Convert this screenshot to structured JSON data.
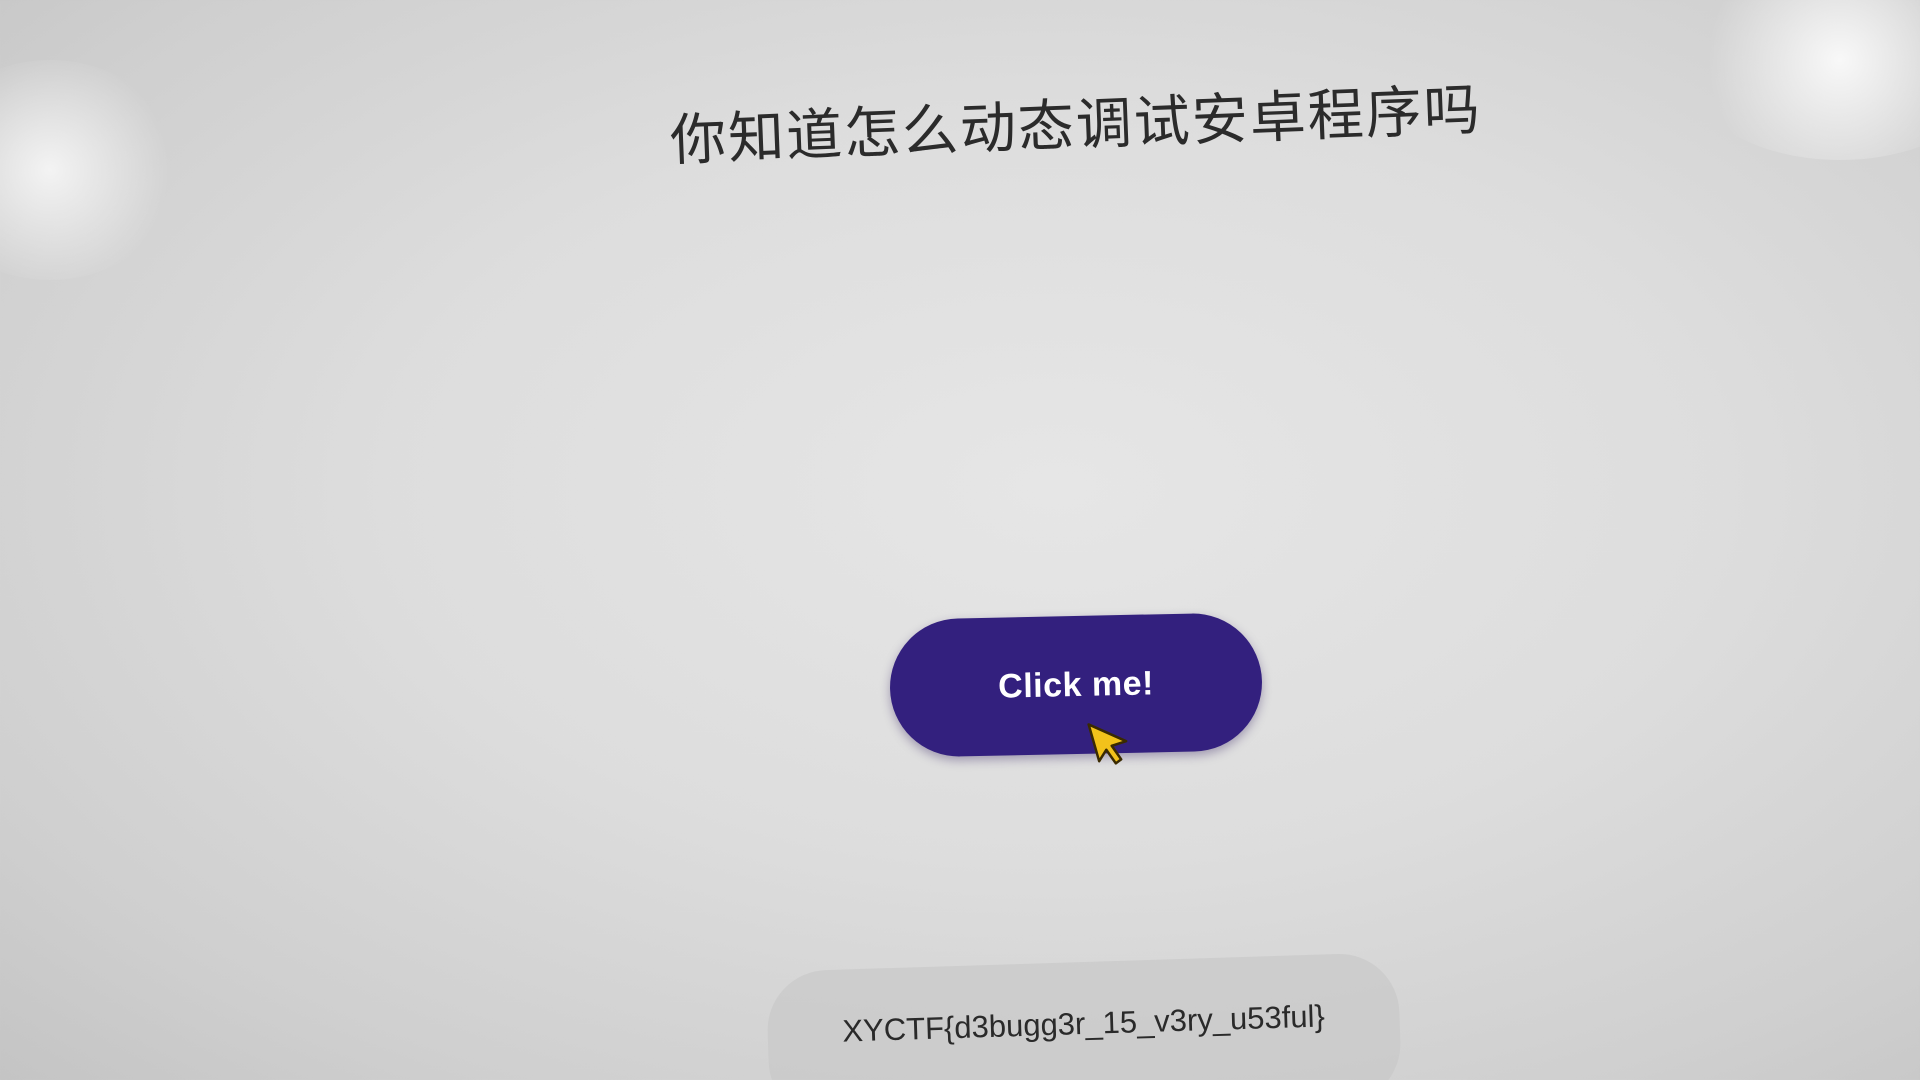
{
  "screen": {
    "title": "你知道怎么动态调试安卓程序吗",
    "button": {
      "label": "Click me!",
      "color": "#33207e"
    },
    "toast": {
      "text": "XYCTF{d3bugg3r_15_v3ry_u53ful}"
    },
    "cursor": {
      "icon": "pointer-arrow-icon",
      "color": "#f2c21b"
    }
  }
}
